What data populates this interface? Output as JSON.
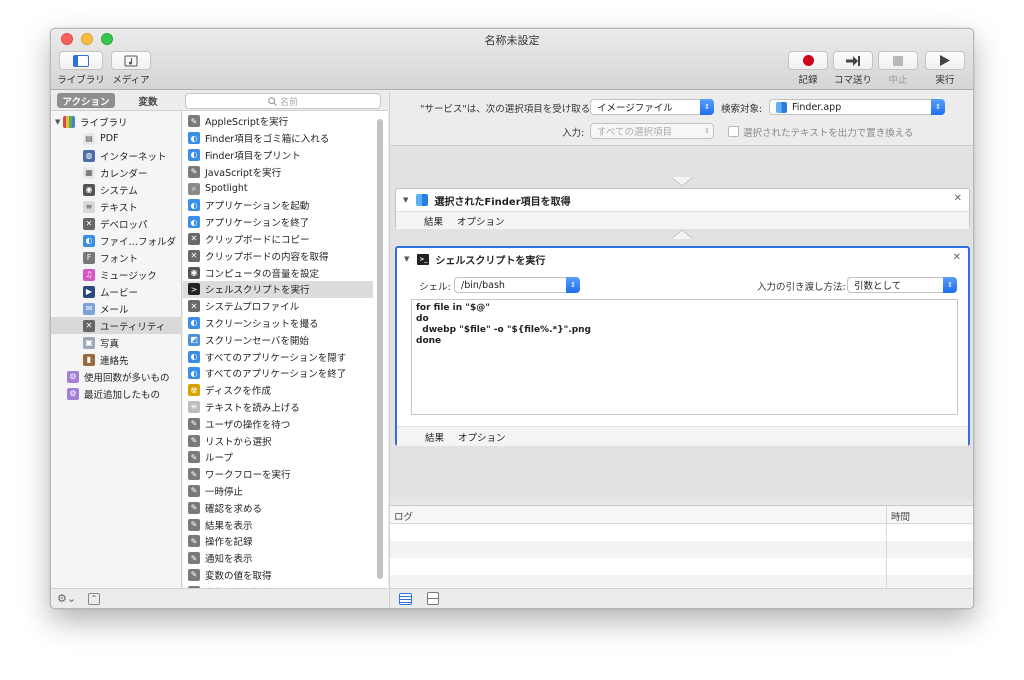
{
  "window": {
    "title": "名称未設定"
  },
  "toolbar": {
    "library_label": "ライブラリ",
    "media_label": "メディア",
    "record_label": "記録",
    "step_label": "コマ送り",
    "stop_label": "中止",
    "run_label": "実行"
  },
  "library": {
    "tab_actions": "アクション",
    "tab_variables": "変数",
    "root": "ライブラリ",
    "items": [
      {
        "label": "PDF",
        "icon": "pdf-icon",
        "color": "#e8e8e8"
      },
      {
        "label": "インターネット",
        "icon": "globe-icon",
        "color": "#4a6fa8"
      },
      {
        "label": "カレンダー",
        "icon": "calendar-icon",
        "color": "#e8e8e8"
      },
      {
        "label": "システム",
        "icon": "system-icon",
        "color": "#555555"
      },
      {
        "label": "テキスト",
        "icon": "text-icon",
        "color": "#d9d9d9"
      },
      {
        "label": "デベロッパ",
        "icon": "developer-icon",
        "color": "#666666"
      },
      {
        "label": "ファイ…フォルダ",
        "icon": "finder-icon",
        "color": "#3a8ee6"
      },
      {
        "label": "フォント",
        "icon": "font-icon",
        "color": "#777777"
      },
      {
        "label": "ミュージック",
        "icon": "music-icon",
        "color": "#d455c4"
      },
      {
        "label": "ムービー",
        "icon": "movie-icon",
        "color": "#2b4a7a"
      },
      {
        "label": "メール",
        "icon": "mail-icon",
        "color": "#7aa2d6"
      },
      {
        "label": "ユーティリティ",
        "icon": "utility-icon",
        "color": "#666666"
      },
      {
        "label": "写真",
        "icon": "photo-icon",
        "color": "#9aa8b8"
      },
      {
        "label": "連絡先",
        "icon": "contacts-icon",
        "color": "#9a6b3a"
      }
    ],
    "smart": [
      {
        "label": "使用回数が多いもの",
        "icon": "smart-folder-icon"
      },
      {
        "label": "最近追加したもの",
        "icon": "smart-folder-icon"
      }
    ]
  },
  "search": {
    "placeholder": "名前"
  },
  "actions": [
    {
      "label": "AppleScriptを実行",
      "icon": "script-icon"
    },
    {
      "label": "Finder項目をゴミ箱に入れる",
      "icon": "finder-icon"
    },
    {
      "label": "Finder項目をプリント",
      "icon": "finder-icon"
    },
    {
      "label": "JavaScriptを実行",
      "icon": "script-icon"
    },
    {
      "label": "Spotlight",
      "icon": "spotlight-icon"
    },
    {
      "label": "アプリケーションを起動",
      "icon": "finder-icon"
    },
    {
      "label": "アプリケーションを終了",
      "icon": "finder-icon"
    },
    {
      "label": "クリップボードにコピー",
      "icon": "utility-icon"
    },
    {
      "label": "クリップボードの内容を取得",
      "icon": "utility-icon"
    },
    {
      "label": "コンピュータの音量を設定",
      "icon": "system-icon"
    },
    {
      "label": "シェルスクリプトを実行",
      "icon": "terminal-icon"
    },
    {
      "label": "システムプロファイル",
      "icon": "utility-icon"
    },
    {
      "label": "スクリーンショットを撮る",
      "icon": "finder-icon"
    },
    {
      "label": "スクリーンセーバを開始",
      "icon": "screensaver-icon"
    },
    {
      "label": "すべてのアプリケーションを隠す",
      "icon": "finder-icon"
    },
    {
      "label": "すべてのアプリケーションを終了",
      "icon": "finder-icon"
    },
    {
      "label": "ディスクを作成",
      "icon": "radioactive-icon"
    },
    {
      "label": "テキストを読み上げる",
      "icon": "text-icon"
    },
    {
      "label": "ユーザの操作を待つ",
      "icon": "script-icon"
    },
    {
      "label": "リストから選択",
      "icon": "script-icon"
    },
    {
      "label": "ループ",
      "icon": "script-icon"
    },
    {
      "label": "ワークフローを実行",
      "icon": "script-icon"
    },
    {
      "label": "一時停止",
      "icon": "script-icon"
    },
    {
      "label": "確認を求める",
      "icon": "script-icon"
    },
    {
      "label": "結果を表示",
      "icon": "script-icon"
    },
    {
      "label": "操作を記録",
      "icon": "script-icon"
    },
    {
      "label": "通知を表示",
      "icon": "script-icon"
    },
    {
      "label": "変数の値を取得",
      "icon": "script-icon"
    },
    {
      "label": "変数の値を設定",
      "icon": "script-icon"
    }
  ],
  "service": {
    "receives_label": "\"サービス\"は、次の選択項目を受け取る:",
    "receives_value": "イメージファイル",
    "target_label": "検索対象:",
    "target_value": "Finder.app",
    "input_label": "入力:",
    "input_value": "すべての選択項目",
    "replace_label": "選択されたテキストを出力で置き換える"
  },
  "workflow": {
    "action1": {
      "title": "選択されたFinder項目を取得",
      "tab_results": "結果",
      "tab_options": "オプション"
    },
    "action2": {
      "title": "シェルスクリプトを実行",
      "shell_label": "シェル:",
      "shell_value": "/bin/bash",
      "pass_label": "入力の引き渡し方法:",
      "pass_value": "引数として",
      "script": "for file in \"$@\"\ndo\n  dwebp \"$file\" -o \"${file%.*}\".png\ndone",
      "tab_results": "結果",
      "tab_options": "オプション"
    }
  },
  "log": {
    "col_log": "ログ",
    "col_time": "時間"
  }
}
